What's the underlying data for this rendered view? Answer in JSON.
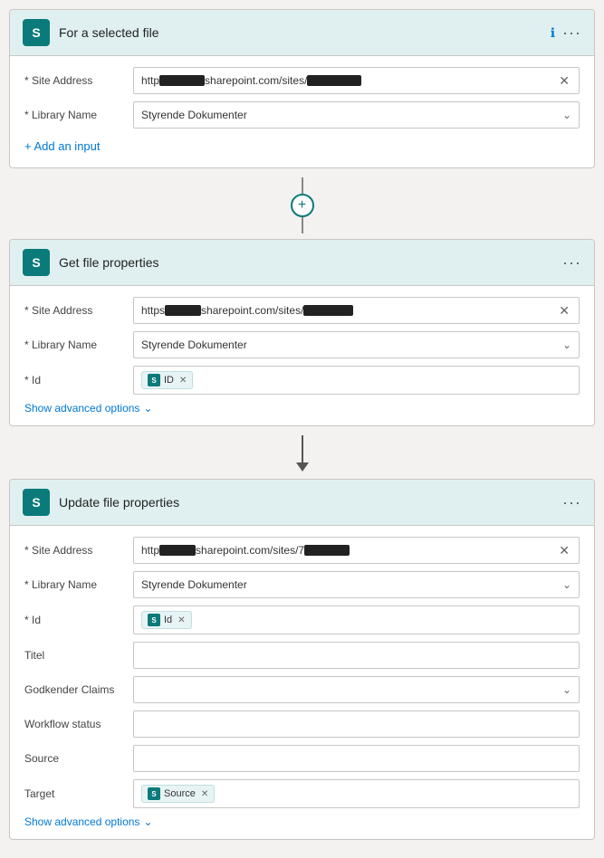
{
  "colors": {
    "accent": "#0a7a7a",
    "link": "#0078d4",
    "border": "#c8c6c4",
    "header_bg": "#d4ecec"
  },
  "card1": {
    "icon": "S",
    "title": "For a selected file",
    "site_address_label": "* Site Address",
    "site_address_prefix": "http",
    "site_address_suffix": "sharepoint.com/sites/",
    "library_name_label": "* Library Name",
    "library_name_value": "Styrende Dokumenter",
    "add_input_label": "+ Add an input"
  },
  "card2": {
    "icon": "S",
    "title": "Get file properties",
    "site_address_label": "* Site Address",
    "site_address_prefix": "https",
    "site_address_suffix": "sharepoint.com/sites/",
    "library_name_label": "* Library Name",
    "library_name_value": "Styrende Dokumenter",
    "id_label": "* Id",
    "id_chip_label": "ID",
    "show_advanced_label": "Show advanced options"
  },
  "card3": {
    "icon": "S",
    "title": "Update file properties",
    "site_address_label": "* Site Address",
    "site_address_prefix": "http",
    "site_address_suffix": "sharepoint.com/sites/7",
    "library_name_label": "* Library Name",
    "library_name_value": "Styrende Dokumenter",
    "id_label": "* Id",
    "id_chip_label": "Id",
    "titel_label": "Titel",
    "godkender_label": "Godkender Claims",
    "workflow_label": "Workflow status",
    "source_label": "Source",
    "target_label": "Target",
    "target_chip_label": "Source",
    "show_advanced_label": "Show advanced options"
  }
}
